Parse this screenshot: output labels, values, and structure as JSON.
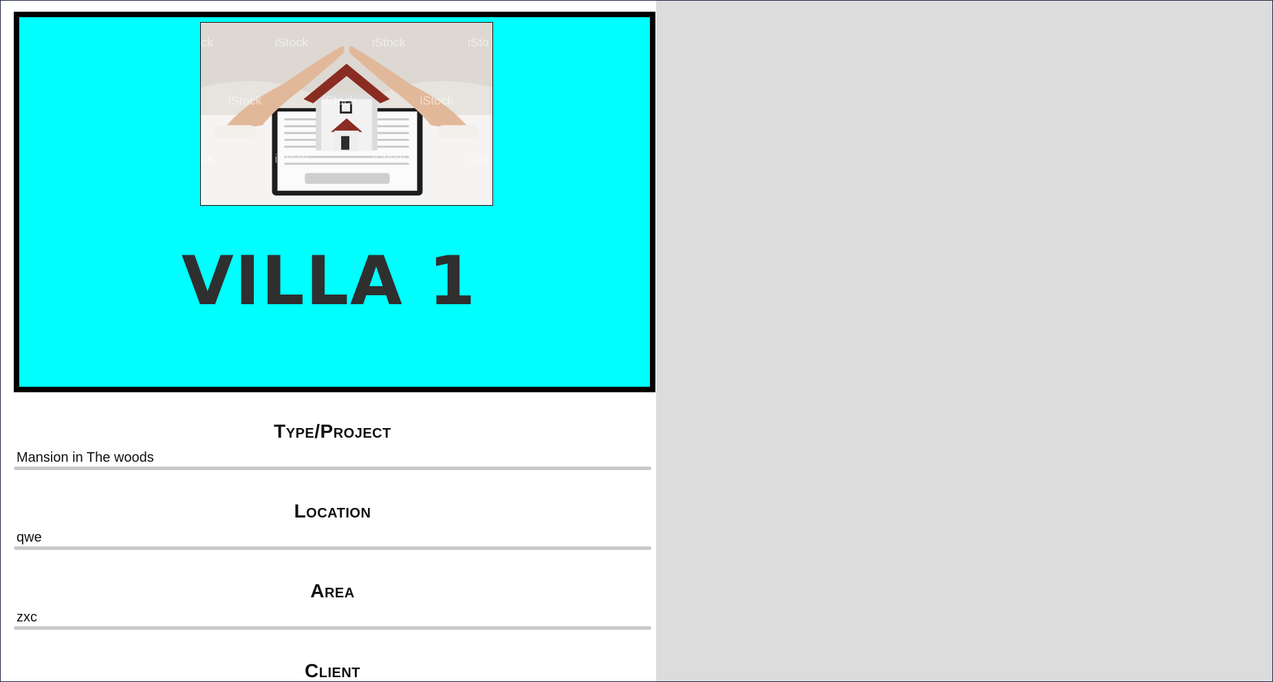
{
  "hero": {
    "title": "VILLA 1",
    "image_alt": "House model under protective hands on insurance papers",
    "colors": {
      "background": "#00ffff",
      "border": "#000000",
      "title": "#2f2f2f"
    }
  },
  "fields": [
    {
      "heading": "Type/Project",
      "value": "Mansion in The woods"
    },
    {
      "heading": "Location",
      "value": "qwe"
    },
    {
      "heading": "Area",
      "value": "zxc"
    },
    {
      "heading": "Client",
      "value": ""
    }
  ],
  "colors": {
    "right_pane": "#dcdcdc",
    "rule": "#c8c8c8"
  }
}
